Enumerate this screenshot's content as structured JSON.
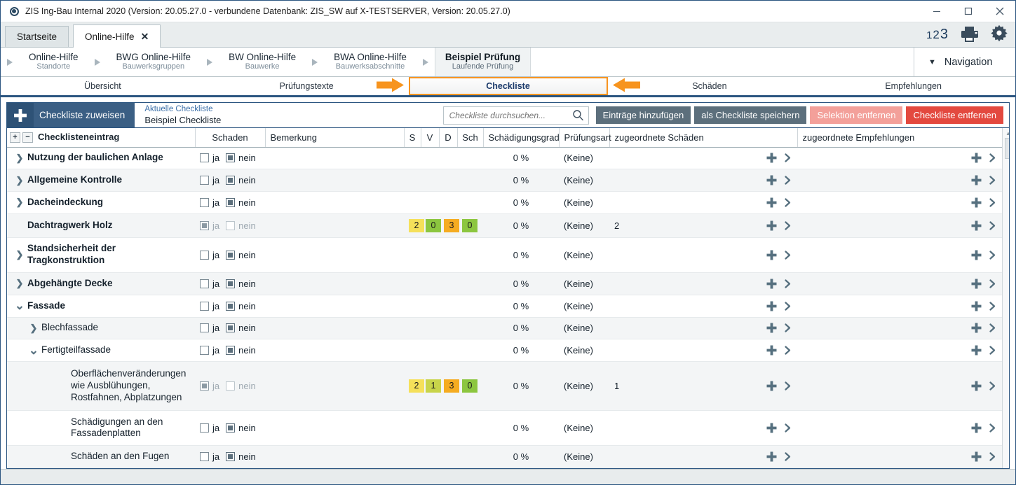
{
  "window": {
    "title": "ZIS Ing-Bau Internal 2020 (Version: 20.05.27.0 - verbundene Datenbank: ZIS_SW auf X-TESTSERVER, Version: 20.05.27.0)",
    "app_icon": "circle-target-icon",
    "minimize": "minimize-icon",
    "maximize": "maximize-icon",
    "close": "close-icon"
  },
  "tabs": {
    "items": [
      {
        "label": "Startseite",
        "active": false,
        "closable": false
      },
      {
        "label": "Online-Hilfe",
        "active": true,
        "closable": true,
        "close_glyph": "✕"
      }
    ],
    "right_icons": {
      "counter": {
        "d1": "1",
        "d2": "2",
        "d3": "3"
      },
      "printer": "printer-icon",
      "gear": "gear-icon"
    }
  },
  "breadcrumb": {
    "items": [
      {
        "main": "Online-Hilfe",
        "sub": "Standorte",
        "current": false
      },
      {
        "main": "BWG Online-Hilfe",
        "sub": "Bauwerksgruppen",
        "current": false
      },
      {
        "main": "BW Online-Hilfe",
        "sub": "Bauwerke",
        "current": false
      },
      {
        "main": "BWA Online-Hilfe",
        "sub": "Bauwerksabschnitte",
        "current": false
      },
      {
        "main": "Beispiel Prüfung",
        "sub": "Laufende Prüfung",
        "current": true
      }
    ],
    "navigation_label": "Navigation",
    "navigation_caret": "▼"
  },
  "sections": {
    "items": [
      {
        "label": "Übersicht",
        "active": false
      },
      {
        "label": "Prüfungstexte",
        "active": false
      },
      {
        "label": "Checkliste",
        "active": true
      },
      {
        "label": "Schäden",
        "active": false
      },
      {
        "label": "Empfehlungen",
        "active": false
      }
    ],
    "active_accent": "#f7941e",
    "annotation_arrows": [
      "arrow-right-annotation",
      "arrow-left-annotation"
    ]
  },
  "toolbar": {
    "assign_button": {
      "label": "Checkliste zuweisen",
      "icon": "plus-icon"
    },
    "current_checklist": {
      "caption": "Aktuelle Checkliste",
      "value": "Beispiel Checkliste"
    },
    "search": {
      "placeholder": "Checkliste durchsuchen...",
      "value": "",
      "icon": "search-icon"
    },
    "buttons": [
      {
        "label": "Einträge hinzufügen",
        "style": "grey"
      },
      {
        "label": "als Checkliste speichern",
        "style": "grey"
      },
      {
        "label": "Selektion entfernen",
        "style": "pink"
      },
      {
        "label": "Checkliste entfernen",
        "style": "red"
      }
    ]
  },
  "table": {
    "expand_all": "+",
    "collapse_all": "−",
    "columns": [
      "Checklisteneintrag",
      "Schaden",
      "Bemerkung",
      "S",
      "V",
      "D",
      "Sch",
      "Schädigungsgrad",
      "Prüfungsart",
      "zugeordnete Schäden",
      "zugeordnete Empfehlungen"
    ],
    "yes_label": "ja",
    "no_label": "nein",
    "rows": [
      {
        "label": "Nutzung der baulichen Anlage",
        "level": 1,
        "bold": true,
        "twisty": "❯",
        "ja": false,
        "nein": true,
        "dim": false,
        "badges": [],
        "grad": "0 %",
        "pruefungsart": "(Keine)",
        "schaeden": "",
        "empfehlungen": ""
      },
      {
        "label": "Allgemeine Kontrolle",
        "level": 1,
        "bold": true,
        "twisty": "❯",
        "ja": false,
        "nein": true,
        "dim": false,
        "badges": [],
        "grad": "0 %",
        "pruefungsart": "(Keine)",
        "schaeden": "",
        "empfehlungen": ""
      },
      {
        "label": "Dacheindeckung",
        "level": 1,
        "bold": true,
        "twisty": "❯",
        "ja": false,
        "nein": true,
        "dim": false,
        "badges": [],
        "grad": "0 %",
        "pruefungsart": "(Keine)",
        "schaeden": "",
        "empfehlungen": ""
      },
      {
        "label": "Dachtragwerk Holz",
        "level": 1,
        "bold": true,
        "twisty": "",
        "ja": true,
        "nein": false,
        "dim": true,
        "badges": [
          {
            "value": "2",
            "color": "#f5e05a"
          },
          {
            "value": "0",
            "color": "#8cc63f"
          },
          {
            "value": "3",
            "color": "#f5ac21"
          },
          {
            "value": "0",
            "color": "#8cc63f"
          }
        ],
        "grad": "0 %",
        "pruefungsart": "(Keine)",
        "schaeden": "2",
        "empfehlungen": ""
      },
      {
        "label": "Standsicherheit der Tragkonstruktion",
        "level": 1,
        "bold": true,
        "twisty": "❯",
        "ja": false,
        "nein": true,
        "dim": false,
        "badges": [],
        "grad": "0 %",
        "pruefungsart": "(Keine)",
        "schaeden": "",
        "empfehlungen": ""
      },
      {
        "label": "Abgehängte Decke",
        "level": 1,
        "bold": true,
        "twisty": "❯",
        "ja": false,
        "nein": true,
        "dim": false,
        "badges": [],
        "grad": "0 %",
        "pruefungsart": "(Keine)",
        "schaeden": "",
        "empfehlungen": ""
      },
      {
        "label": "Fassade",
        "level": 1,
        "bold": true,
        "twisty": "❯",
        "expanded": true,
        "ja": false,
        "nein": true,
        "dim": false,
        "badges": [],
        "grad": "0 %",
        "pruefungsart": "(Keine)",
        "schaeden": "",
        "empfehlungen": ""
      },
      {
        "label": "Blechfassade",
        "level": 2,
        "bold": false,
        "twisty": "❯",
        "ja": false,
        "nein": true,
        "dim": false,
        "badges": [],
        "grad": "0 %",
        "pruefungsart": "(Keine)",
        "schaeden": "",
        "empfehlungen": ""
      },
      {
        "label": "Fertigteilfassade",
        "level": 2,
        "bold": false,
        "twisty": "❯",
        "expanded": true,
        "ja": false,
        "nein": true,
        "dim": false,
        "badges": [],
        "grad": "0 %",
        "pruefungsart": "(Keine)",
        "schaeden": "",
        "empfehlungen": ""
      },
      {
        "label": "Oberflächenveränderungen wie Ausblühungen, Rostfahnen, Abplatzungen",
        "level": 3,
        "bold": false,
        "twisty": "",
        "ja": true,
        "nein": false,
        "dim": true,
        "badges": [
          {
            "value": "2",
            "color": "#f5e05a"
          },
          {
            "value": "1",
            "color": "#c8d44a"
          },
          {
            "value": "3",
            "color": "#f5ac21"
          },
          {
            "value": "0",
            "color": "#8cc63f"
          }
        ],
        "grad": "0 %",
        "pruefungsart": "(Keine)",
        "schaeden": "1",
        "empfehlungen": ""
      },
      {
        "label": "Schädigungen an den Fassadenplatten",
        "level": 3,
        "bold": false,
        "twisty": "",
        "ja": false,
        "nein": true,
        "dim": false,
        "badges": [],
        "grad": "0 %",
        "pruefungsart": "(Keine)",
        "schaeden": "",
        "empfehlungen": ""
      },
      {
        "label": "Schäden an den Fugen",
        "level": 3,
        "bold": false,
        "twisty": "",
        "ja": false,
        "nein": true,
        "dim": false,
        "badges": [],
        "grad": "0 %",
        "pruefungsart": "(Keine)",
        "schaeden": "",
        "empfehlungen": ""
      }
    ],
    "row_action_icons": [
      "plus-icon",
      "chevron-right-icon"
    ],
    "scrollbar": {
      "up": "▲",
      "down": "▼"
    }
  },
  "statusbar": {
    "items": [
      "",
      "",
      "",
      ""
    ]
  }
}
